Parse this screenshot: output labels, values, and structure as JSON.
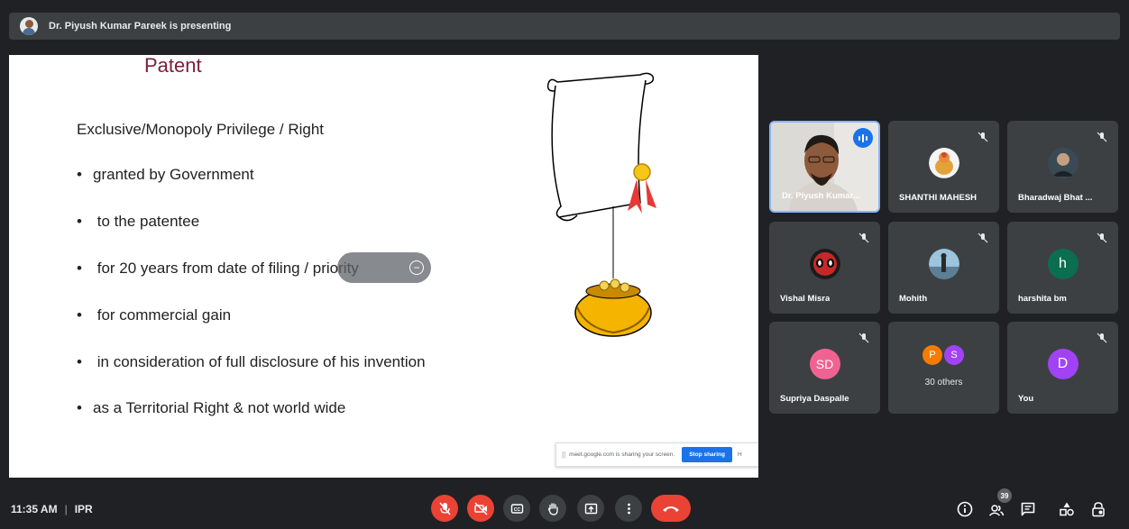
{
  "presenter": {
    "text": "Dr. Piyush Kumar Pareek is presenting"
  },
  "slide": {
    "title": "Patent",
    "heading": "Exclusive/Monopoly Privilege / Right",
    "bullets": [
      "granted by Government",
      "to the patentee",
      "for 20 years from date of filing / priority",
      "for commercial gain",
      "in consideration of full disclosure of his invention",
      "as a Territorial Right & not world wide"
    ],
    "bullet_char": "•"
  },
  "share_bar": {
    "message": "meet.google.com is sharing your screen.",
    "stop_label": "Stop sharing",
    "hide_label": "H"
  },
  "participants": [
    {
      "name": "Dr. Piyush Kumar...",
      "speaking": true
    },
    {
      "name": "SHANTHI MAHESH",
      "muted": true
    },
    {
      "name": "Bharadwaj Bhat ...",
      "muted": true
    },
    {
      "name": "Vishal Misra",
      "muted": true
    },
    {
      "name": "Mohith",
      "muted": true
    },
    {
      "name": "harshita bm",
      "initial": "h",
      "color": "#0b6e4f",
      "muted": true
    },
    {
      "name": "Supriya Daspalle",
      "initial": "SD",
      "color": "#f06292",
      "muted": true
    },
    {
      "name": "30 others",
      "initials": [
        "P",
        "S"
      ],
      "colors": [
        "#f57c00",
        "#a142f4"
      ]
    },
    {
      "name": "You",
      "initial": "D",
      "color": "#a142f4",
      "muted": true
    }
  ],
  "bottom_bar": {
    "time": "11:35 AM",
    "separator": "|",
    "meeting": "IPR",
    "participant_count": "39"
  },
  "icons": {
    "mic": "mic-off-icon",
    "camera": "camera-off-icon",
    "captions": "captions-icon",
    "hand": "raise-hand-icon",
    "present": "present-icon",
    "more": "more-icon",
    "end": "end-call-icon",
    "info": "info-icon",
    "people": "people-icon",
    "chat": "chat-icon",
    "activities": "activities-icon",
    "lock": "host-controls-icon"
  }
}
